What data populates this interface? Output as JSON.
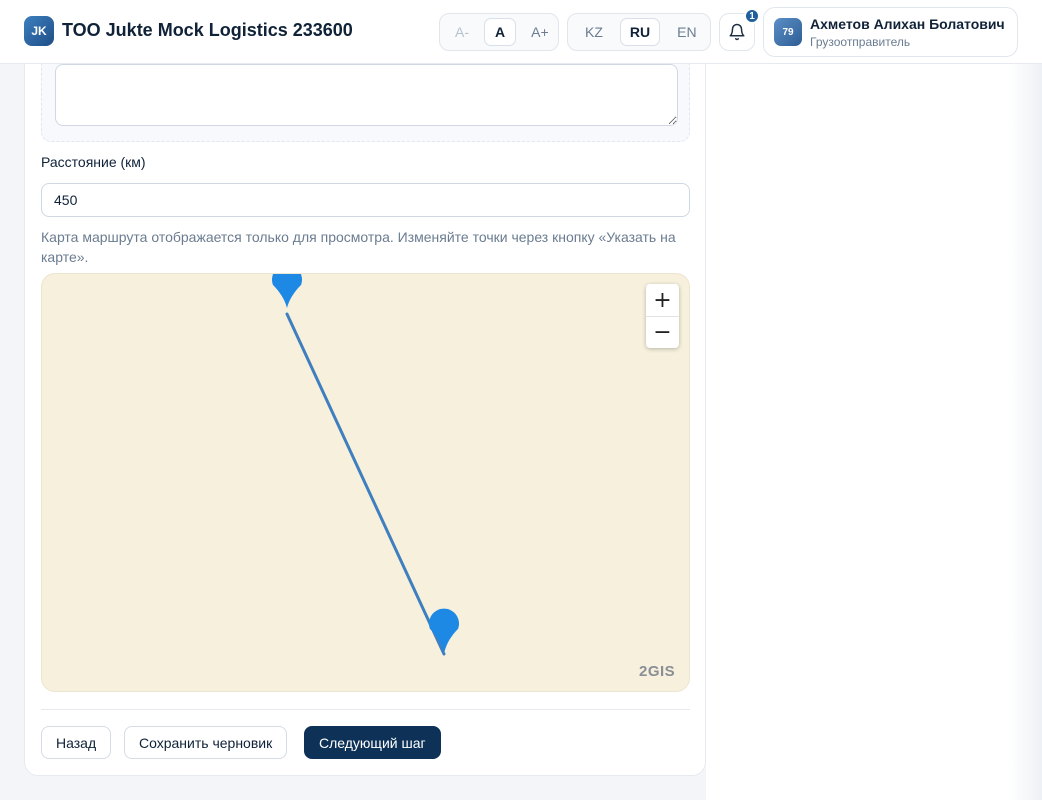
{
  "header": {
    "logo_text": "JK",
    "company_title": "TOO Jukte Mock Logistics 233600",
    "font_size": {
      "decrease": "A-",
      "normal": "A",
      "increase": "A+"
    },
    "languages": [
      {
        "label": "KZ",
        "active": false
      },
      {
        "label": "RU",
        "active": true
      },
      {
        "label": "EN",
        "active": false
      }
    ],
    "notifications": {
      "count": "1",
      "icon": "bell-icon"
    },
    "user": {
      "avatar_text": "79",
      "name": "Ахметов Алихан Болатович",
      "role": "Грузоотправитель"
    }
  },
  "form": {
    "comment_value": "",
    "distance_label": "Расстояние (км)",
    "distance_value": "450",
    "map_hint": "Карта маршрута отображается только для просмотра. Изменяйте точки через кнопку «Указать на карте».",
    "map": {
      "provider_logo": "2GIS",
      "zoom_in": "+",
      "zoom_out": "−",
      "route_color": "#3f7fbf",
      "marker_color": "#1e88e5",
      "background_color": "#f6f0dc"
    }
  },
  "actions": {
    "back_label": "Назад",
    "save_draft_label": "Сохранить черновик",
    "next_label": "Следующий шаг"
  }
}
